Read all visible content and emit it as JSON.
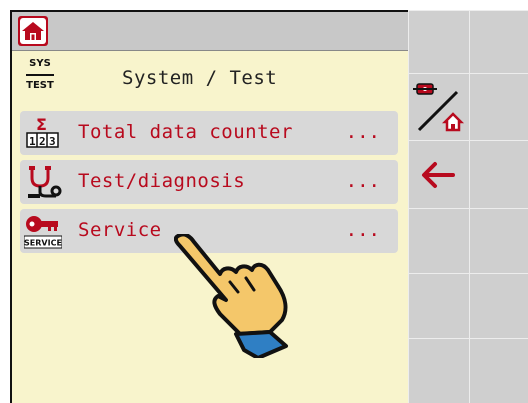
{
  "header": {
    "home_icon": "home-icon"
  },
  "title_bar": {
    "badge_top": "SYS",
    "badge_bottom": "TEST",
    "title": "System / Test"
  },
  "menu": {
    "items": [
      {
        "label": "Total data counter",
        "suffix": "...",
        "icon": "sigma-counter-icon"
      },
      {
        "label": "Test/diagnosis",
        "suffix": "...",
        "icon": "stethoscope-icon"
      },
      {
        "label": "Service",
        "suffix": "...",
        "icon": "service-key-icon",
        "icon_caption": "SERVICE"
      }
    ]
  },
  "softkeys": {
    "keys": [
      {
        "icon": "blank"
      },
      {
        "icon": "machine-home-toggle-icon"
      },
      {
        "icon": "back-arrow-icon"
      },
      {
        "icon": "blank"
      },
      {
        "icon": "blank"
      },
      {
        "icon": "blank"
      }
    ]
  },
  "overlay": {
    "icon": "pointing-hand-icon"
  },
  "colors": {
    "accent": "#b80a1e",
    "background": "#f8f4cc",
    "item": "#d8d8d8",
    "softkey": "#cfcfcf",
    "hand": "#f4c76a",
    "cuff": "#2f7fc4"
  }
}
